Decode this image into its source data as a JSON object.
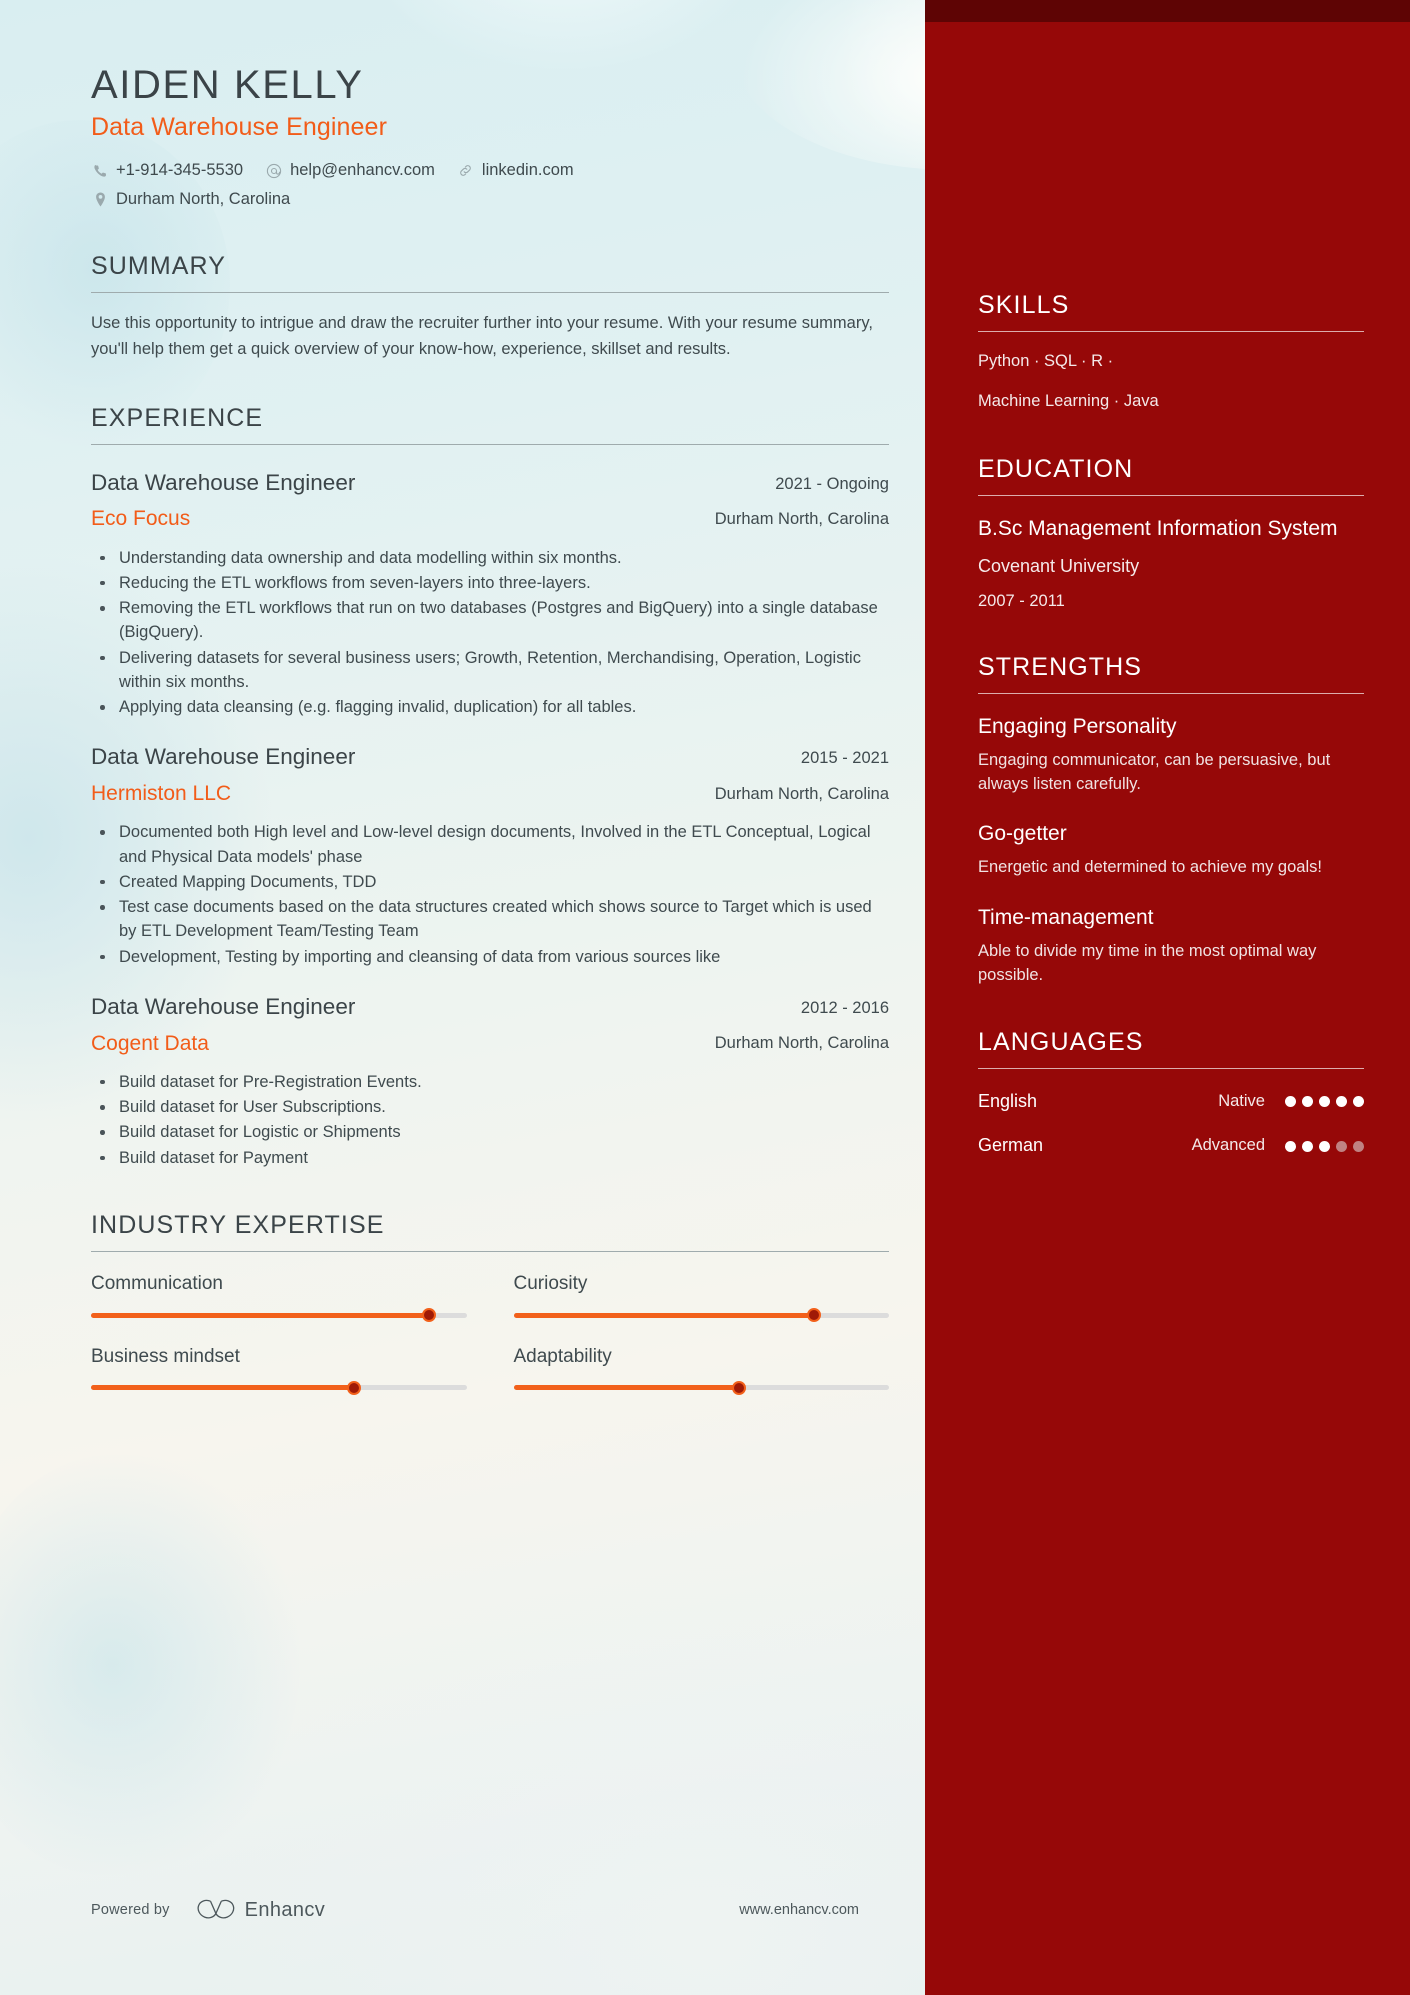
{
  "header": {
    "name": "AIDEN KELLY",
    "job_title": "Data Warehouse Engineer",
    "contacts": {
      "phone": "+1-914-345-5530",
      "email": "help@enhancv.com",
      "link": "linkedin.com",
      "location": "Durham North, Carolina"
    }
  },
  "summary": {
    "heading": "SUMMARY",
    "text": "Use this opportunity to intrigue and draw the recruiter further into your resume. With your resume summary, you'll help them get a quick overview of your know-how, experience, skillset and results."
  },
  "experience": {
    "heading": "EXPERIENCE",
    "jobs": [
      {
        "role": "Data Warehouse Engineer",
        "company": "Eco Focus",
        "dates": "2021 - Ongoing",
        "location": "Durham North, Carolina",
        "bullets": [
          "Understanding data ownership and data modelling within six months.",
          "Reducing the ETL workflows from seven-layers into three-layers.",
          "Removing the ETL workflows that run on two databases (Postgres and BigQuery) into a single database (BigQuery).",
          "Delivering datasets for several business users; Growth, Retention, Merchandising, Operation, Logistic within six months.",
          "Applying data cleansing (e.g. flagging invalid, duplication) for all tables."
        ]
      },
      {
        "role": "Data Warehouse Engineer",
        "company": "Hermiston LLC",
        "dates": "2015 - 2021",
        "location": "Durham North, Carolina",
        "bullets": [
          "Documented both High level and Low-level design documents, Involved in the ETL Conceptual, Logical and Physical Data models' phase",
          "Created Mapping Documents, TDD",
          "Test case documents based on the data structures created which shows source to Target which is used by ETL Development Team/Testing Team",
          "Development, Testing by importing and cleansing of data from various sources like"
        ]
      },
      {
        "role": "Data Warehouse Engineer",
        "company": "Cogent Data",
        "dates": "2012 - 2016",
        "location": "Durham North, Carolina",
        "bullets": [
          "Build dataset for Pre-Registration Events.",
          "Build dataset for User Subscriptions.",
          "Build dataset for Logistic or Shipments",
          "Build dataset for Payment"
        ]
      }
    ]
  },
  "industry_expertise": {
    "heading": "INDUSTRY EXPERTISE",
    "items": [
      {
        "label": "Communication",
        "value": 90
      },
      {
        "label": "Curiosity",
        "value": 80
      },
      {
        "label": "Business mindset",
        "value": 70
      },
      {
        "label": "Adaptability",
        "value": 60
      }
    ]
  },
  "skills": {
    "heading": "SKILLS",
    "lines": [
      "Python · SQL ·  R  ·",
      "Machine Learning · Java"
    ],
    "items": [
      "Python",
      "SQL",
      "R",
      "Machine Learning",
      "Java"
    ]
  },
  "education": {
    "heading": "EDUCATION",
    "entries": [
      {
        "degree": "B.Sc Management Information System",
        "school": "Covenant University",
        "years": "2007 - 2011"
      }
    ]
  },
  "strengths": {
    "heading": "STRENGTHS",
    "items": [
      {
        "title": "Engaging Personality",
        "description": "Engaging communicator, can be persuasive, but always listen carefully."
      },
      {
        "title": "Go-getter",
        "description": "Energetic and determined to achieve my goals!"
      },
      {
        "title": "Time-management",
        "description": "Able to divide my time in the most optimal way possible."
      }
    ]
  },
  "languages": {
    "heading": "LANGUAGES",
    "items": [
      {
        "name": "English",
        "level": "Native",
        "filled": 5,
        "total": 5
      },
      {
        "name": "German",
        "level": "Advanced",
        "filled": 3,
        "total": 5
      }
    ]
  },
  "footer": {
    "powered_by": "Powered by",
    "brand": "Enhancv",
    "url": "www.enhancv.com"
  },
  "colors": {
    "accent_orange": "#f25c19",
    "sidebar_red": "#960808",
    "sidebar_strip": "#5e0404",
    "heading_dark": "#3b4448",
    "body_text": "#3f4a4e",
    "background": "#e2f0f2"
  }
}
